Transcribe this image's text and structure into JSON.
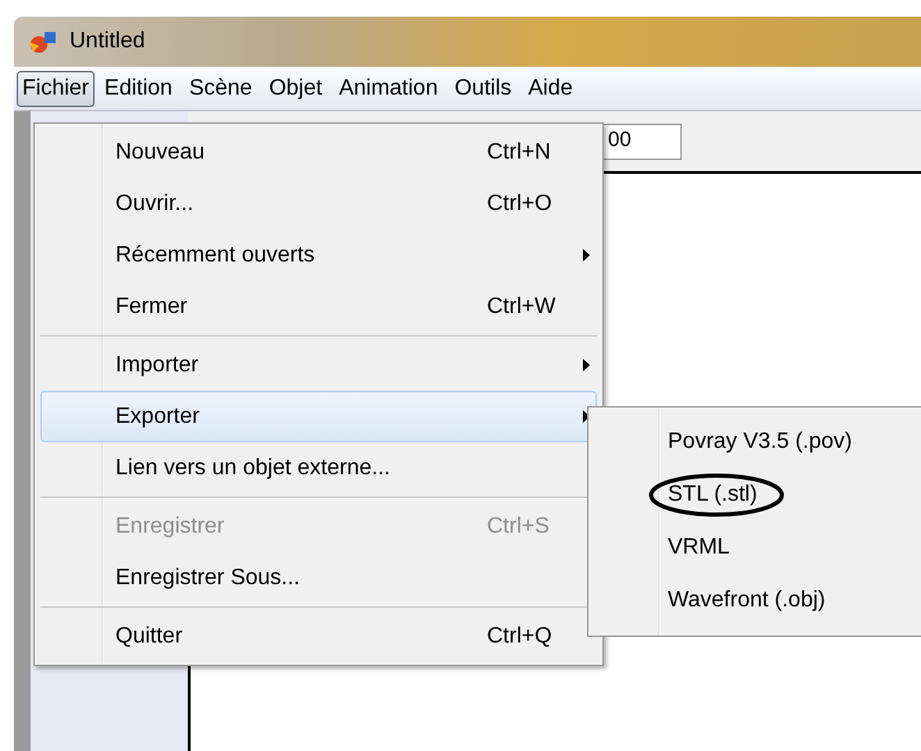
{
  "window": {
    "title": "Untitled"
  },
  "menubar": [
    {
      "label": "Fichier",
      "selected": true
    },
    {
      "label": "Edition",
      "selected": false
    },
    {
      "label": "Scène",
      "selected": false
    },
    {
      "label": "Objet",
      "selected": false
    },
    {
      "label": "Animation",
      "selected": false
    },
    {
      "label": "Outils",
      "selected": false
    },
    {
      "label": "Aide",
      "selected": false
    }
  ],
  "toolbar": {
    "field_value": "00"
  },
  "menu": [
    {
      "kind": "item",
      "label": "Nouveau",
      "shortcut": "Ctrl+N",
      "submenu": false,
      "disabled": false,
      "selected": false
    },
    {
      "kind": "item",
      "label": "Ouvrir...",
      "shortcut": "Ctrl+O",
      "submenu": false,
      "disabled": false,
      "selected": false
    },
    {
      "kind": "item",
      "label": "Récemment ouverts",
      "submenu": true,
      "disabled": false,
      "selected": false
    },
    {
      "kind": "item",
      "label": "Fermer",
      "shortcut": "Ctrl+W",
      "submenu": false,
      "disabled": false,
      "selected": false
    },
    {
      "kind": "separator"
    },
    {
      "kind": "item",
      "label": "Importer",
      "submenu": true,
      "disabled": false,
      "selected": false
    },
    {
      "kind": "item",
      "label": "Exporter",
      "submenu": true,
      "disabled": false,
      "selected": true
    },
    {
      "kind": "item",
      "label": "Lien vers un objet externe...",
      "submenu": false,
      "disabled": false,
      "selected": false
    },
    {
      "kind": "separator"
    },
    {
      "kind": "item",
      "label": "Enregistrer",
      "shortcut": "Ctrl+S",
      "submenu": false,
      "disabled": true,
      "selected": false
    },
    {
      "kind": "item",
      "label": "Enregistrer Sous...",
      "submenu": false,
      "disabled": false,
      "selected": false
    },
    {
      "kind": "separator"
    },
    {
      "kind": "item",
      "label": "Quitter",
      "shortcut": "Ctrl+Q",
      "submenu": false,
      "disabled": false,
      "selected": false
    }
  ],
  "submenu": [
    {
      "label": "Povray V3.5 (.pov)",
      "circled": false
    },
    {
      "label": "STL (.stl)",
      "circled": true
    },
    {
      "label": "VRML",
      "circled": false
    },
    {
      "label": "Wavefront (.obj)",
      "circled": false
    }
  ]
}
